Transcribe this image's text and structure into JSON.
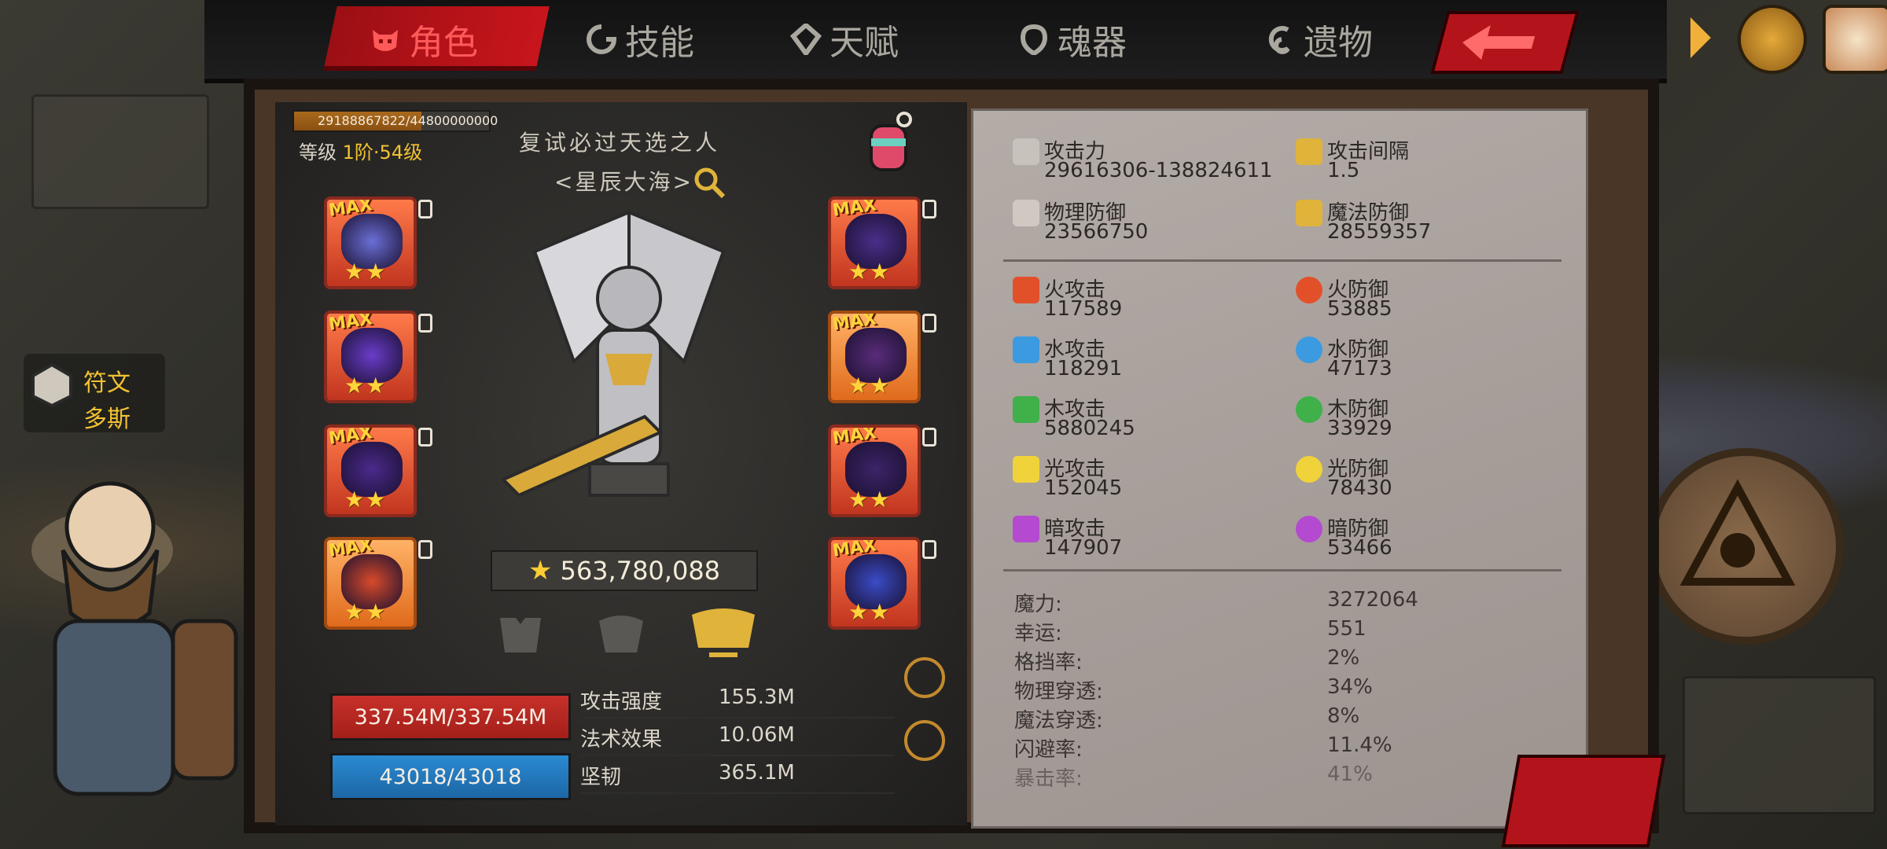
{
  "tabs": [
    {
      "label": "角色",
      "icon": "demon-face-icon",
      "active": true
    },
    {
      "label": "技能",
      "icon": "skill-swirl-icon",
      "active": false
    },
    {
      "label": "天赋",
      "icon": "talent-emblem-icon",
      "active": false
    },
    {
      "label": "魂器",
      "icon": "soul-vessel-icon",
      "active": false
    },
    {
      "label": "遗物",
      "icon": "relic-swirl-icon",
      "active": false
    }
  ],
  "top_right": {
    "back": "back-arrow-icon",
    "expand": "chevron-right-icon",
    "crown": "crown-chest-icon",
    "calendar": "calendar-check-icon"
  },
  "character": {
    "exp_text": "29188867822/44800000000",
    "exp_fraction": 0.6515,
    "level_label": "等级",
    "level_value": "1阶·54级",
    "title": "复试必过天选之人",
    "guild": "<星辰大海>",
    "power": "563,780,088",
    "hp": "337.54M/337.54M",
    "mp": "43018/43018"
  },
  "equipment_left": [
    {
      "badge": "MAX",
      "stars": "★★",
      "color": "#6a6fd6"
    },
    {
      "badge": "MAX",
      "stars": "★★",
      "color": "#6a3cc9"
    },
    {
      "badge": "MAX",
      "stars": "★★",
      "color": "#4b2a8c"
    },
    {
      "badge": "MAX",
      "stars": "★★",
      "color": "#d84a2a"
    }
  ],
  "equipment_right": [
    {
      "badge": "MAX",
      "stars": "★★",
      "color": "#4a2f8a"
    },
    {
      "badge": "MAX",
      "stars": "★★",
      "color": "#5a2c7a"
    },
    {
      "badge": "MAX",
      "stars": "★★",
      "color": "#3c2468"
    },
    {
      "badge": "MAX",
      "stars": "★★",
      "color": "#3a4cc8"
    }
  ],
  "mini_stats": [
    {
      "label": "攻击强度",
      "value": "155.3M"
    },
    {
      "label": "法术效果",
      "value": "10.06M"
    },
    {
      "label": "坚韧",
      "value": "365.1M"
    }
  ],
  "main_stats": [
    {
      "label": "攻击力",
      "value": "29616306-138824611",
      "icon": "sword-icon",
      "color": "#c7c2bc"
    },
    {
      "label": "攻击间隔",
      "value": "1.5",
      "icon": "golden-sword-icon",
      "color": "#e0b33a"
    },
    {
      "label": "物理防御",
      "value": "23566750",
      "icon": "dagger-icon",
      "color": "#cfc9c2"
    },
    {
      "label": "魔法防御",
      "value": "28559357",
      "icon": "hammer-icon",
      "color": "#e0b33a"
    }
  ],
  "element_stats": [
    {
      "label": "火攻击",
      "value": "117589",
      "icon": "fire-attack-icon",
      "color": "#e2502a"
    },
    {
      "label": "火防御",
      "value": "53885",
      "icon": "fire-defense-icon",
      "color": "#e2502a"
    },
    {
      "label": "水攻击",
      "value": "118291",
      "icon": "water-attack-icon",
      "color": "#3c9ae0"
    },
    {
      "label": "水防御",
      "value": "47173",
      "icon": "water-defense-icon",
      "color": "#3c9ae0"
    },
    {
      "label": "木攻击",
      "value": "5880245",
      "icon": "wood-attack-icon",
      "color": "#3fb04a"
    },
    {
      "label": "木防御",
      "value": "33929",
      "icon": "wood-defense-icon",
      "color": "#3fb04a"
    },
    {
      "label": "光攻击",
      "value": "152045",
      "icon": "light-attack-icon",
      "color": "#f0d23a"
    },
    {
      "label": "光防御",
      "value": "78430",
      "icon": "light-defense-icon",
      "color": "#f0d23a"
    },
    {
      "label": "暗攻击",
      "value": "147907",
      "icon": "dark-attack-icon",
      "color": "#b44ad0"
    },
    {
      "label": "暗防御",
      "value": "53466",
      "icon": "dark-defense-icon",
      "color": "#b44ad0"
    }
  ],
  "extra_stats": [
    {
      "label": "魔力:",
      "value": "3272064"
    },
    {
      "label": "幸运:",
      "value": "551"
    },
    {
      "label": "格挡率:",
      "value": "2%"
    },
    {
      "label": "物理穿透:",
      "value": "34%"
    },
    {
      "label": "魔法穿透:",
      "value": "8%"
    },
    {
      "label": "闪避率:",
      "value": "11.4%"
    },
    {
      "label": "暴击率:",
      "value": "41%"
    }
  ],
  "side": {
    "rune": "符文",
    "rune_sub": "多斯"
  },
  "colors": {
    "accent_red": "#c8151c",
    "gold": "#f1c232",
    "hp": "#c8302a",
    "mp": "#2a8ad2"
  }
}
